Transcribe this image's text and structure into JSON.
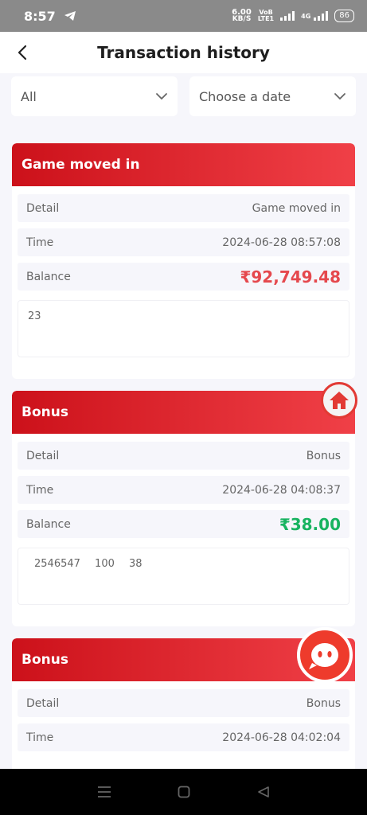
{
  "status": {
    "time": "8:57",
    "net_speed": "6.00",
    "net_unit": "KB/S",
    "volte_top": "VoB",
    "volte_bottom": "LTE1",
    "lte": "4G",
    "battery": "86"
  },
  "header": {
    "title": "Transaction history"
  },
  "filters": {
    "type": "All",
    "date": "Choose a date"
  },
  "labels": {
    "detail": "Detail",
    "time": "Time",
    "balance": "Balance"
  },
  "transactions": [
    {
      "title": "Game moved in",
      "detail": "Game moved in",
      "time": "2024-06-28 08:57:08",
      "balance": "₹92,749.48",
      "balance_color": "#e5484d",
      "note": [
        "23"
      ]
    },
    {
      "title": "Bonus",
      "detail": "Bonus",
      "time": "2024-06-28 04:08:37",
      "balance": "₹38.00",
      "balance_color": "#18b360",
      "note": [
        "2546547",
        "100",
        "38"
      ]
    },
    {
      "title": "Bonus",
      "detail": "Bonus",
      "time": "2024-06-28 04:02:04"
    }
  ],
  "colors": {
    "header_red_start": "#cc111a",
    "header_red_end": "#f04047",
    "balance_red": "#e5484d",
    "balance_green": "#18b360"
  },
  "icons": [
    "back-arrow-icon",
    "chevron-down-icon",
    "home-icon",
    "chat-bot-icon",
    "menu-icon",
    "home-square-icon",
    "back-triangle-icon"
  ]
}
